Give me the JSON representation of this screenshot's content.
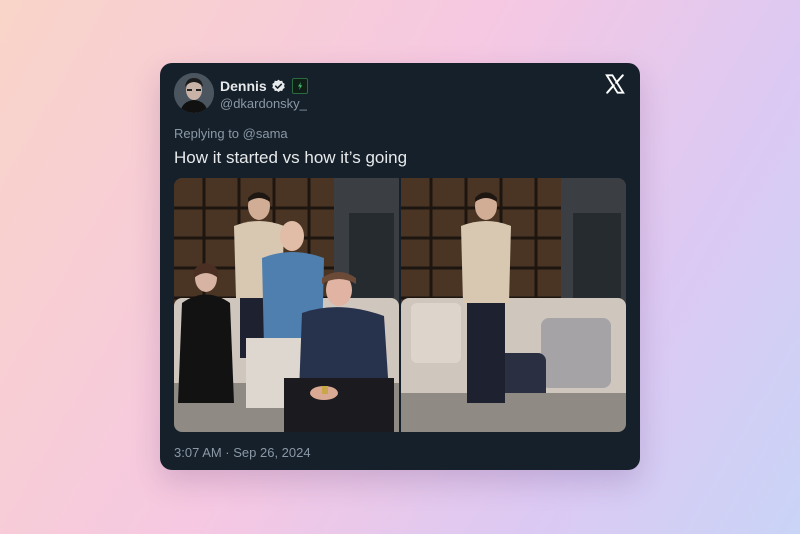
{
  "tweet": {
    "display_name": "Dennis",
    "handle": "@dkardonsky_",
    "reply_prefix": "Replying to ",
    "reply_to": "@sama",
    "text": "How it started vs how it’s going",
    "timestamp": "3:07 AM · Sep 26, 2024"
  },
  "icons": {
    "platform": "x-logo-icon",
    "verified": "verified-badge-icon",
    "app_badge": "app-badge-icon"
  },
  "colors": {
    "card_background": "#15202b",
    "text_primary": "#e7e9ea",
    "text_secondary": "#8b98a5"
  }
}
